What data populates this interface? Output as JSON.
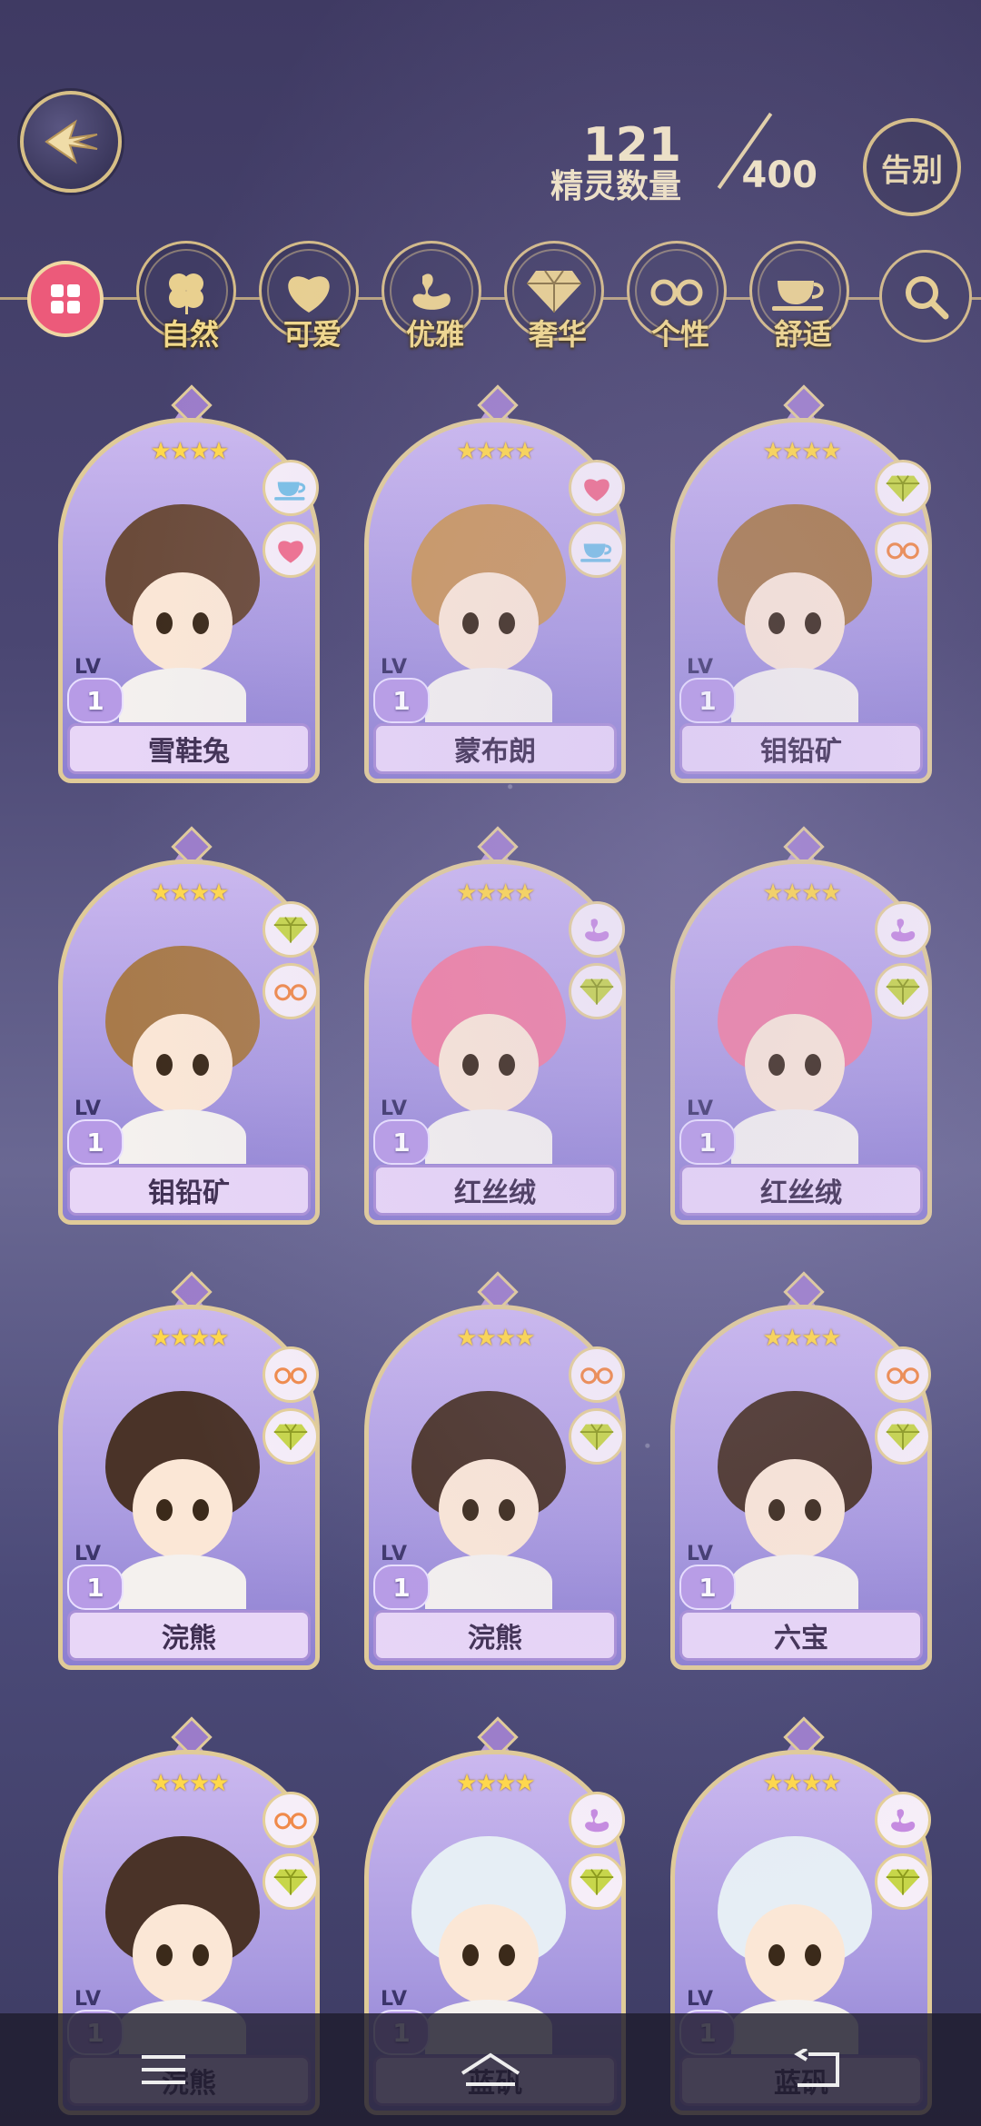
{
  "header": {
    "count_current": "121",
    "count_label": "精灵数量",
    "count_total": "400",
    "farewell_label": "告别"
  },
  "filters": [
    {
      "label": "自然",
      "icon": "clover-icon"
    },
    {
      "label": "可爱",
      "icon": "heart-icon"
    },
    {
      "label": "优雅",
      "icon": "swan-icon"
    },
    {
      "label": "奢华",
      "icon": "diamond-icon"
    },
    {
      "label": "个性",
      "icon": "glasses-icon"
    },
    {
      "label": "舒适",
      "icon": "teacup-icon"
    }
  ],
  "spirits": [
    {
      "name": "雪鞋兔",
      "level": "1",
      "lv_label": "LV",
      "stars": "★★★★",
      "traits": [
        "teacup-icon",
        "heart-icon"
      ],
      "hair": "#6b4b3a"
    },
    {
      "name": "蒙布朗",
      "level": "1",
      "lv_label": "LV",
      "stars": "★★★★",
      "traits": [
        "heart-icon",
        "teacup-icon"
      ],
      "hair": "#c9965e"
    },
    {
      "name": "钼铅矿",
      "level": "1",
      "lv_label": "LV",
      "stars": "★★★★",
      "traits": [
        "diamond-icon",
        "glasses-icon"
      ],
      "hair": "#a87a4a"
    },
    {
      "name": "钼铅矿",
      "level": "1",
      "lv_label": "LV",
      "stars": "★★★★",
      "traits": [
        "diamond-icon",
        "glasses-icon"
      ],
      "hair": "#a87a4a"
    },
    {
      "name": "红丝绒",
      "level": "1",
      "lv_label": "LV",
      "stars": "★★★★",
      "traits": [
        "swan-icon",
        "diamond-icon"
      ],
      "hair": "#ef7fa2"
    },
    {
      "name": "红丝绒",
      "level": "1",
      "lv_label": "LV",
      "stars": "★★★★",
      "traits": [
        "swan-icon",
        "diamond-icon"
      ],
      "hair": "#ef7fa2"
    },
    {
      "name": "浣熊",
      "level": "1",
      "lv_label": "LV",
      "stars": "★★★★",
      "traits": [
        "glasses-icon",
        "diamond-icon"
      ],
      "hair": "#4a3328"
    },
    {
      "name": "浣熊",
      "level": "1",
      "lv_label": "LV",
      "stars": "★★★★",
      "traits": [
        "glasses-icon",
        "diamond-icon"
      ],
      "hair": "#4a3328"
    },
    {
      "name": "六宝",
      "level": "1",
      "lv_label": "LV",
      "stars": "★★★★",
      "traits": [
        "glasses-icon",
        "diamond-icon"
      ],
      "hair": "#4a3328"
    },
    {
      "name": "浣熊",
      "level": "1",
      "lv_label": "LV",
      "stars": "★★★★",
      "traits": [
        "glasses-icon",
        "diamond-icon"
      ],
      "hair": "#4a3328"
    },
    {
      "name": "蓝矾",
      "level": "1",
      "lv_label": "LV",
      "stars": "★★★★",
      "traits": [
        "swan-icon",
        "diamond-icon"
      ],
      "hair": "#e6eef5"
    },
    {
      "name": "蓝矾",
      "level": "1",
      "lv_label": "LV",
      "stars": "★★★★",
      "traits": [
        "swan-icon",
        "diamond-icon"
      ],
      "hair": "#e6eef5"
    }
  ],
  "colors": {
    "accent_gold": "#d7bf86",
    "filter_label": "#f2d98a",
    "all_button": "#ec5a7a"
  },
  "nav": [
    "menu-icon",
    "home-icon",
    "back-icon"
  ]
}
